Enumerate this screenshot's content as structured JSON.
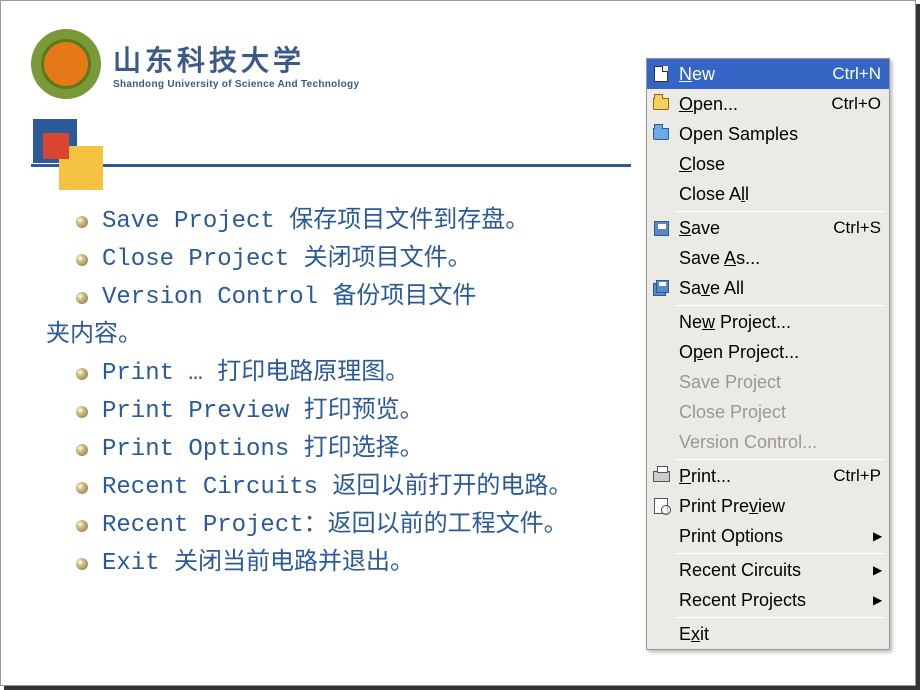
{
  "header": {
    "uni_cn": "山东科技大学",
    "uni_en": "Shandong University of Science And Technology"
  },
  "items": [
    {
      "text": "Save Project  保存项目文件到存盘。"
    },
    {
      "text": "Close Project  关闭项目文件。"
    },
    {
      "text": "Version Control  备份项目文件",
      "wrap": "夹内容。"
    },
    {
      "text": "Print … 打印电路原理图。"
    },
    {
      "text": "Print Preview  打印预览。"
    },
    {
      "text": "Print Options  打印选择。"
    },
    {
      "text": "Recent Circuits 返回以前打开的电路。"
    },
    {
      "text": "Recent Project：返回以前的工程文件。"
    },
    {
      "text": "Exit 关闭当前电路并退出。"
    }
  ],
  "menu": [
    {
      "icon": "ic-new",
      "label": "New",
      "u": 0,
      "shortcut": "Ctrl+N",
      "selected": true
    },
    {
      "icon": "ic-open",
      "label": "Open...",
      "u": 0,
      "shortcut": "Ctrl+O"
    },
    {
      "icon": "ic-open-blue",
      "label": "Open Samples"
    },
    {
      "icon": "",
      "label": "Close",
      "u": 0
    },
    {
      "icon": "",
      "label": "Close All",
      "u": 7
    },
    {
      "sep": true
    },
    {
      "icon": "ic-save",
      "label": "Save",
      "u": 0,
      "shortcut": "Ctrl+S"
    },
    {
      "icon": "",
      "label": "Save As...",
      "u": 5
    },
    {
      "icon": "ic-saveall",
      "label": "Save All",
      "u": 2
    },
    {
      "sep": true
    },
    {
      "icon": "",
      "label": "New Project...",
      "u": 2
    },
    {
      "icon": "",
      "label": "Open Project...",
      "u": 1
    },
    {
      "icon": "",
      "label": "Save Project",
      "disabled": true
    },
    {
      "icon": "",
      "label": "Close Project",
      "disabled": true
    },
    {
      "icon": "",
      "label": "Version Control...",
      "disabled": true
    },
    {
      "sep": true
    },
    {
      "icon": "ic-print",
      "label": "Print...",
      "u": 0,
      "shortcut": "Ctrl+P"
    },
    {
      "icon": "ic-preview",
      "label": "Print Preview",
      "u": 9
    },
    {
      "icon": "",
      "label": "Print Options",
      "submenu": true
    },
    {
      "sep": true
    },
    {
      "icon": "",
      "label": "Recent Circuits",
      "submenu": true
    },
    {
      "icon": "",
      "label": "Recent Projects",
      "submenu": true
    },
    {
      "sep": true
    },
    {
      "icon": "",
      "label": "Exit",
      "u": 1
    }
  ]
}
